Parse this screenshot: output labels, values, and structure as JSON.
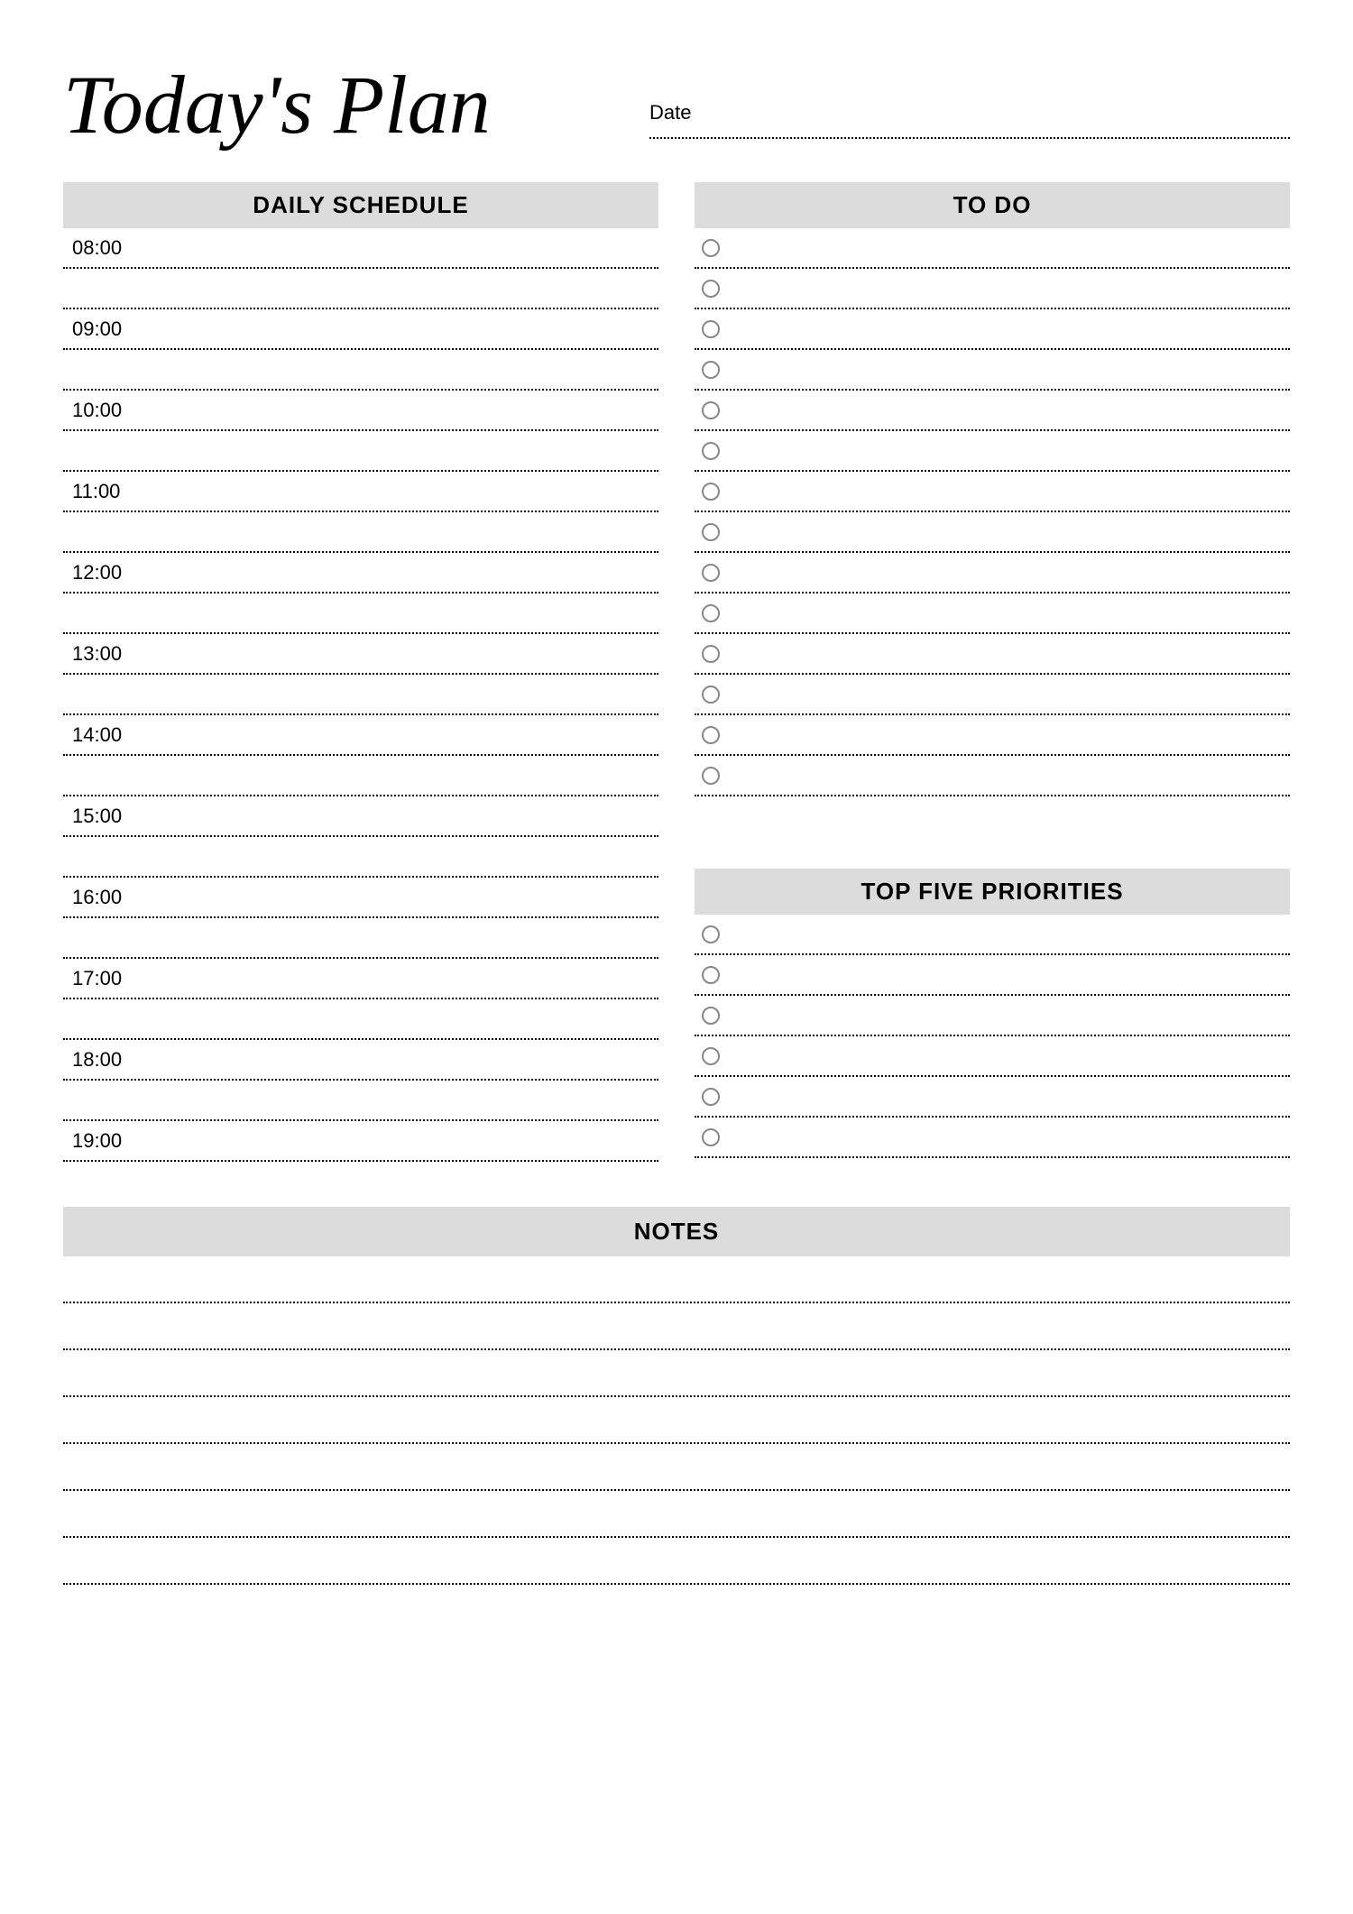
{
  "header": {
    "title": "Today's Plan",
    "date_label": "Date"
  },
  "sections": {
    "schedule_title": "DAILY SCHEDULE",
    "todo_title": "TO DO",
    "priorities_title": "TOP FIVE PRIORITIES",
    "notes_title": "NOTES"
  },
  "schedule_hours": [
    "08:00",
    "09:00",
    "10:00",
    "11:00",
    "12:00",
    "13:00",
    "14:00",
    "15:00",
    "16:00",
    "17:00",
    "18:00",
    "19:00"
  ],
  "todo_count": 14,
  "priorities_count": 6,
  "notes_lines": 7
}
